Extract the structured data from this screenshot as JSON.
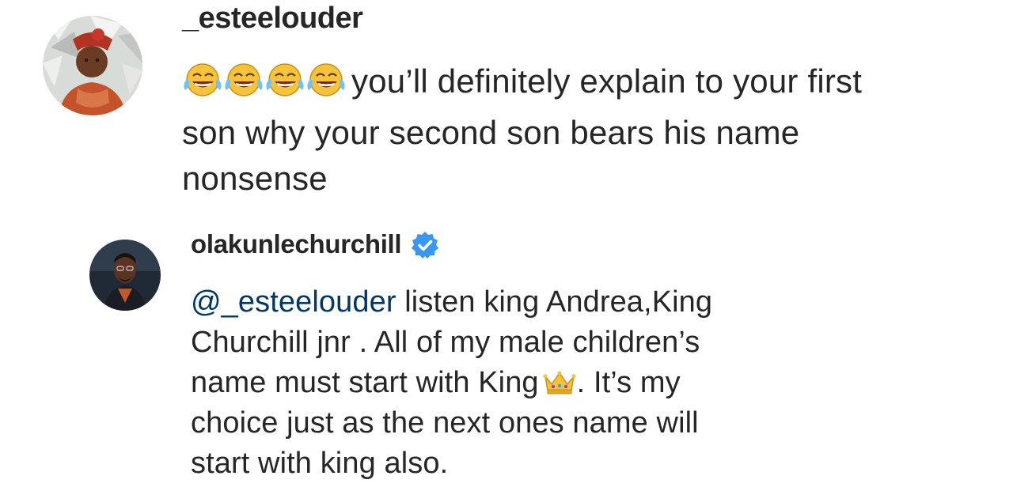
{
  "comments": [
    {
      "username": "_esteelouder",
      "verified": false,
      "emoji_icon": "face-with-tears-of-joy-icon",
      "emoji_count": 4,
      "lines": [
        "you’ll definitely explain to your first",
        "son why your second son bears his name",
        "nonsense"
      ]
    },
    {
      "username": "olakunlechurchill",
      "verified": true,
      "mention": "@_esteelouder",
      "lines": [
        " listen king Andrea,King",
        "Churchill jnr .  All of my male children’s",
        "name must start with King",
        ". It’s my",
        "choice just as the next ones name will",
        "start with king also."
      ],
      "inline_emoji_icon": "crown-icon"
    }
  ],
  "colors": {
    "text": "#262626",
    "verified_badge": "#3897f0",
    "background": "#ffffff"
  }
}
